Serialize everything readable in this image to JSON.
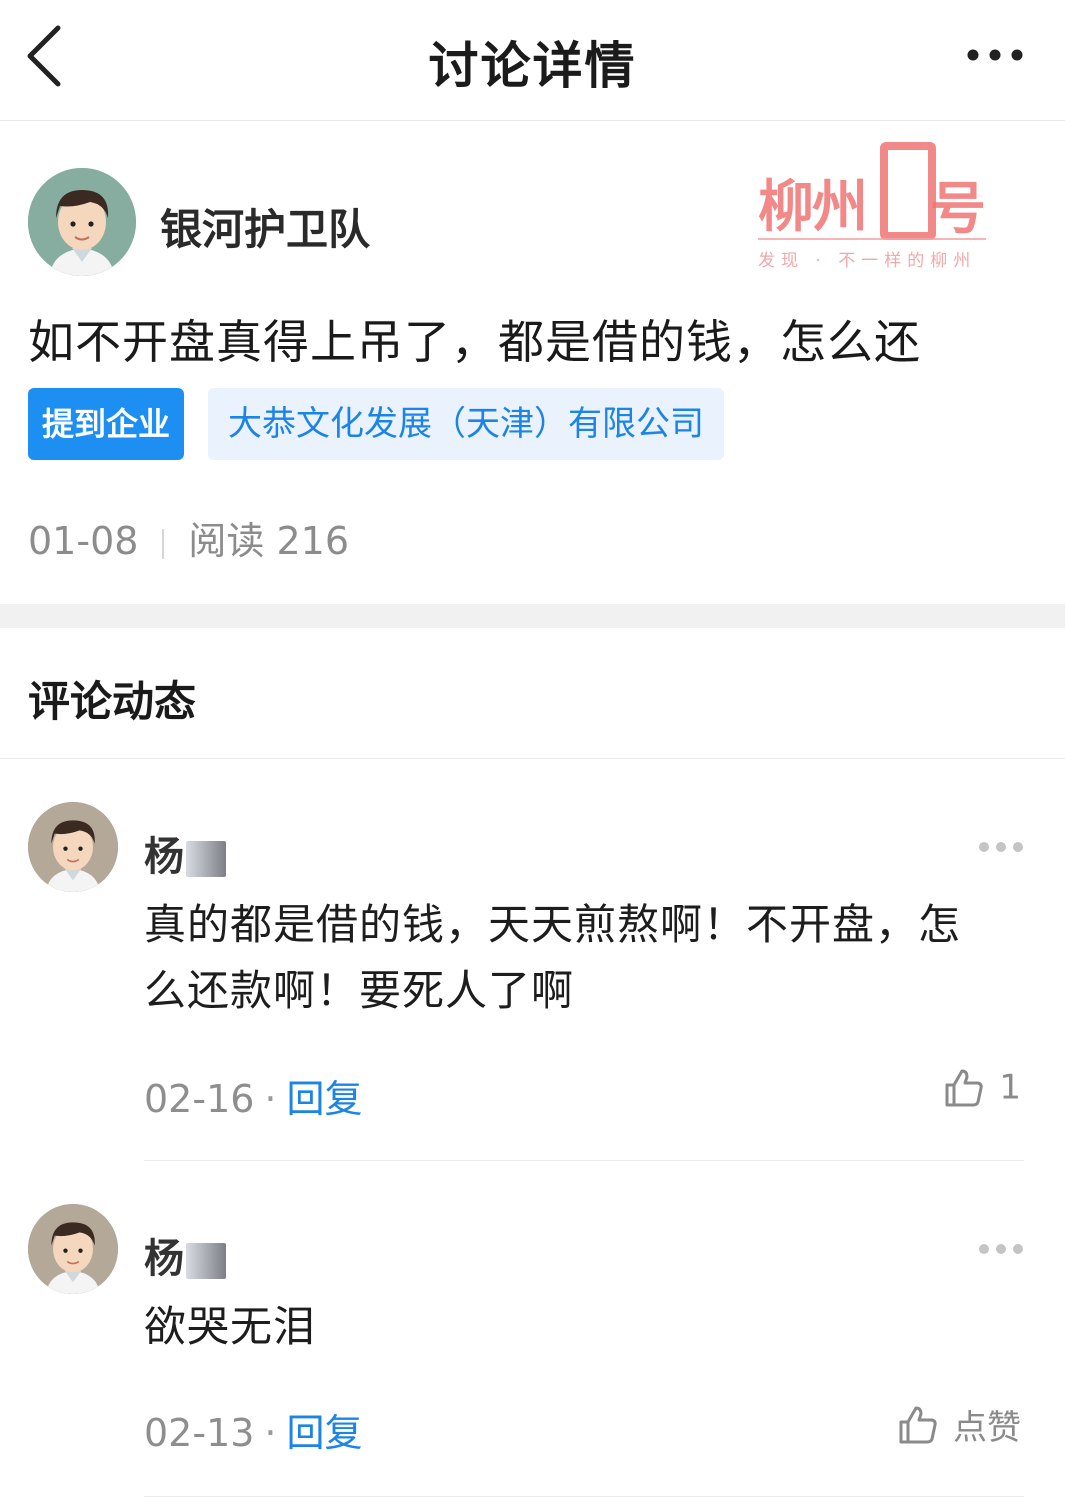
{
  "nav": {
    "title": "讨论详情",
    "back_icon": "chevron-left-icon",
    "more_icon": "more-horizontal-icon"
  },
  "post": {
    "author": "银河护卫队",
    "content": "如不开盘真得上吊了，都是借的钱，怎么还",
    "tag_label": "提到企业",
    "company": "大恭文化发展（天津）有限公司",
    "date": "01-08",
    "reads": "阅读 216"
  },
  "watermark": {
    "text": "柳州",
    "hao": "号",
    "slogan": "发现 · 不一样的柳州"
  },
  "comments_section": {
    "title": "评论动态"
  },
  "comments": [
    {
      "name": "杨",
      "text_line1": "真的都是借的钱，天天煎熬啊！不开盘，怎",
      "text_line2": "么还款啊！要死人了啊",
      "date": "02-16",
      "separator": "·",
      "reply": "回复",
      "likes": "1"
    },
    {
      "name": "杨",
      "text_line1": "欲哭无泪",
      "date": "02-13",
      "separator": "·",
      "reply": "回复",
      "likes": "点赞"
    }
  ],
  "colors": {
    "accent": "#1d8ff3",
    "link": "#1c84e6",
    "tag_bg": "#eaf3fd",
    "watermark": "#f07474",
    "meta": "#8c8c8c"
  }
}
